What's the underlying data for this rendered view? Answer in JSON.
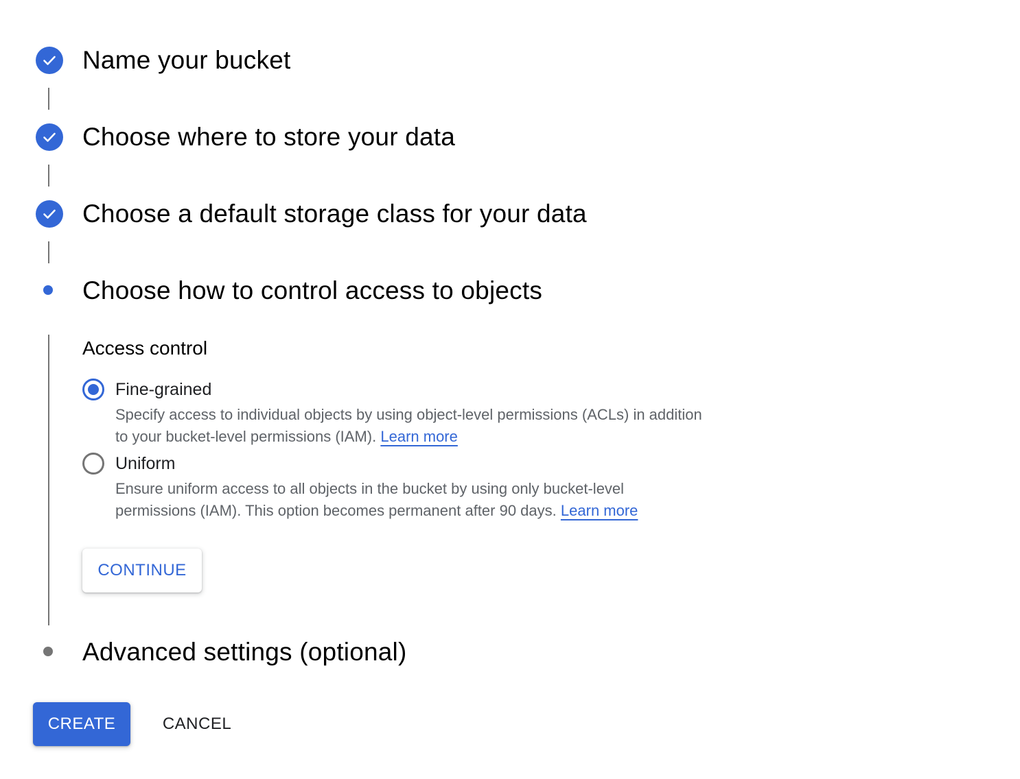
{
  "steps": [
    {
      "title": "Name your bucket",
      "state": "completed",
      "icon": "check-icon"
    },
    {
      "title": "Choose where to store your data",
      "state": "completed",
      "icon": "check-icon"
    },
    {
      "title": "Choose a default storage class for your data",
      "state": "completed",
      "icon": "check-icon"
    },
    {
      "title": "Choose how to control access to objects",
      "state": "active",
      "icon": "dot-icon"
    },
    {
      "title": "Advanced settings (optional)",
      "state": "inactive",
      "icon": "dot-icon"
    }
  ],
  "access_control": {
    "heading": "Access control",
    "options": [
      {
        "label": "Fine-grained",
        "selected": true,
        "description": "Specify access to individual objects by using object-level permissions (ACLs) in addition to your bucket-level permissions (IAM).",
        "link": "Learn more"
      },
      {
        "label": "Uniform",
        "selected": false,
        "description": "Ensure uniform access to all objects in the bucket by using only bucket-level permissions (IAM). This option becomes permanent after 90 days.",
        "link": "Learn more"
      }
    ],
    "continue_label": "CONTINUE"
  },
  "actions": {
    "create_label": "CREATE",
    "cancel_label": "CANCEL"
  },
  "colors": {
    "accent": "#3367d6",
    "inactive": "#757575",
    "text": "#202124",
    "secondary_text": "#5f6368"
  }
}
